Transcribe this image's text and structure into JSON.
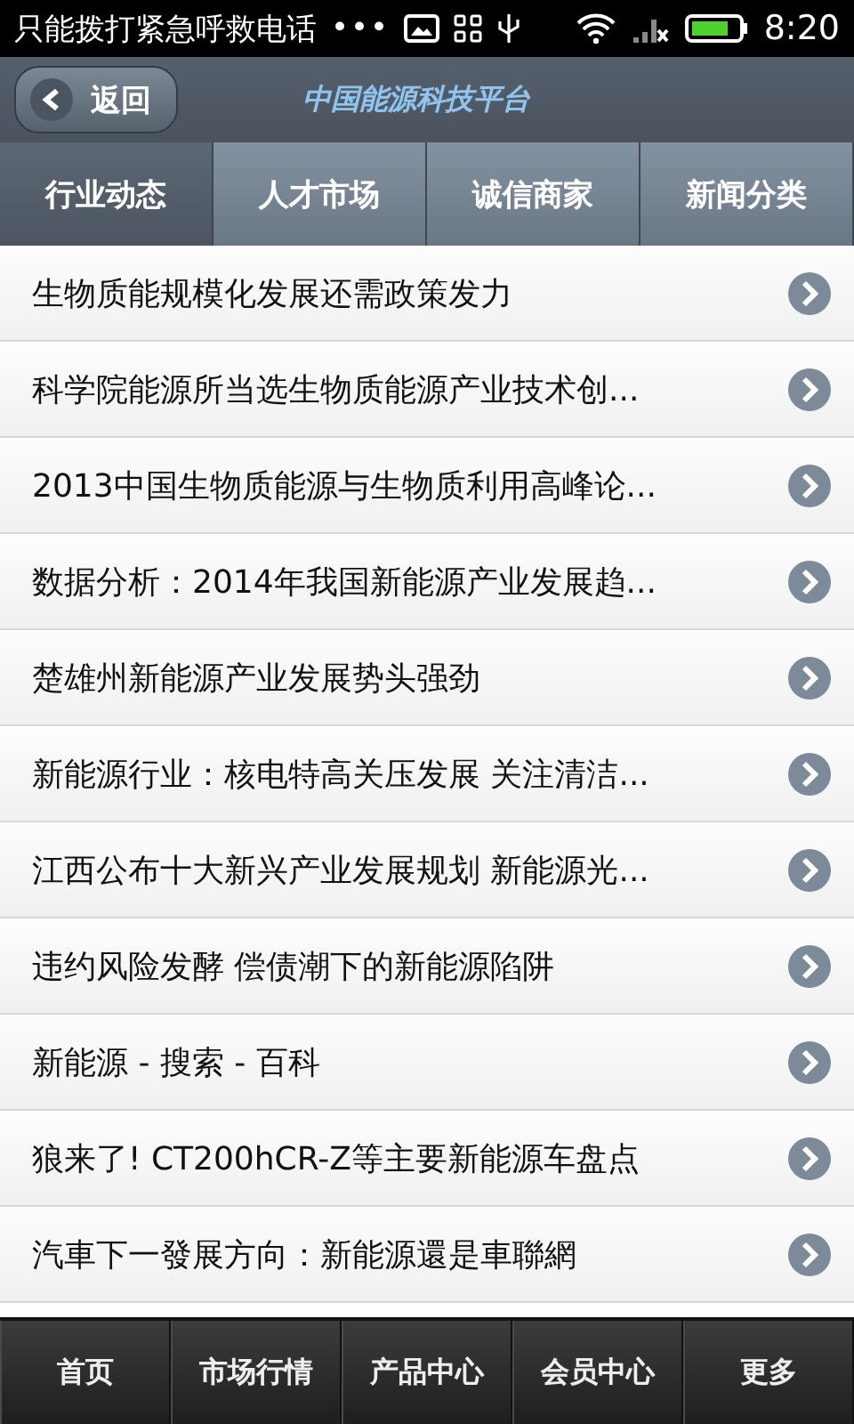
{
  "status_bar": {
    "notification": "只能拨打紧急呼救电话",
    "more": "•••",
    "time": "8:20"
  },
  "header": {
    "back_button": "返回",
    "title": "中国能源科技平台"
  },
  "tabs": [
    {
      "label": "行业动态",
      "selected": true
    },
    {
      "label": "人才市场",
      "selected": false
    },
    {
      "label": "诚信商家",
      "selected": false
    },
    {
      "label": "新闻分类",
      "selected": false
    }
  ],
  "news": [
    {
      "title": "生物质能规模化发展还需政策发力"
    },
    {
      "title": "科学院能源所当选生物质能源产业技术创..."
    },
    {
      "title": "2013中国生物质能源与生物质利用高峰论..."
    },
    {
      "title": "数据分析：2014年我国新能源产业发展趋..."
    },
    {
      "title": "楚雄州新能源产业发展势头强劲"
    },
    {
      "title": "新能源行业：核电特高关压发展 关注清洁..."
    },
    {
      "title": "江西公布十大新兴产业发展规划 新能源光..."
    },
    {
      "title": "违约风险发酵 偿债潮下的新能源陷阱"
    },
    {
      "title": "新能源 - 搜索 - 百科"
    },
    {
      "title": "狼来了! CT200hCR-Z等主要新能源车盘点"
    },
    {
      "title": "汽車下一發展方向：新能源還是車聯網"
    }
  ],
  "bottom_nav": [
    {
      "label": "首页"
    },
    {
      "label": "市场行情"
    },
    {
      "label": "产品中心"
    },
    {
      "label": "会员中心"
    },
    {
      "label": "更多"
    }
  ]
}
